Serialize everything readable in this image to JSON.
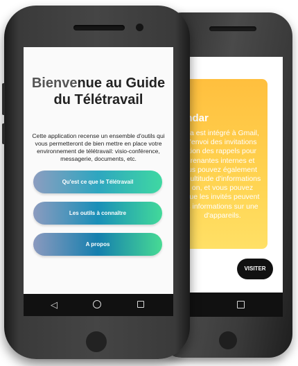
{
  "back_phone": {
    "card_title": "endar",
    "card_text": "da est intégré à Gmail,\nl'envoi des invitations\ntion des rappels pour\nrenantes internes et\nus pouvez également\nmultitude d'informations\non, et vous pouvez\nque les invités peuvent\ns informations sur une\nd'appareils.",
    "visit_label": "VISITER"
  },
  "front_phone": {
    "title_part_1": "Bienve",
    "title_part_2": "nue au Guide",
    "title_line_2": "du Télétravail",
    "description": "Cette application recense un ensemble d'outils qui vous permetteront de bien mettre en place votre environnement de télétravail: visio-conférence, messagerie, documents, etc.",
    "buttons": [
      {
        "label": "Qu'est ce que le Télétravail"
      },
      {
        "label": "Les outils à connaître"
      },
      {
        "label": "A propos"
      }
    ],
    "nav": {
      "back_icon": "back-triangle-icon",
      "home_icon": "home-circle-icon",
      "recent_icon": "recent-square-icon"
    }
  },
  "colors": {
    "card_gradient_start": "#ffbf3e",
    "card_gradient_end": "#ffe066",
    "button_gradient_start": "#8c9dc0",
    "button_gradient_end": "#3fd8a2"
  }
}
